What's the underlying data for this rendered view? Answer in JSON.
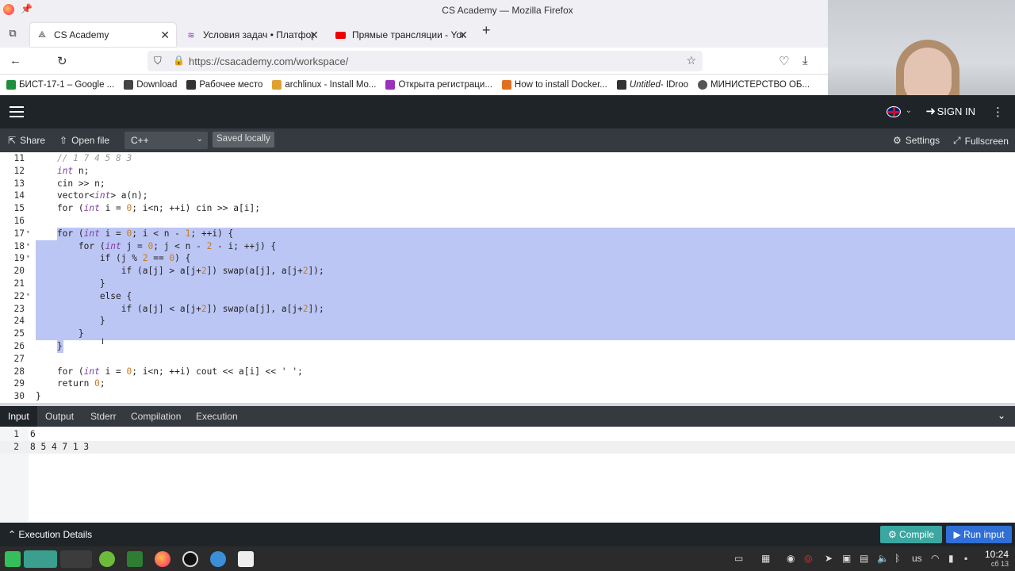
{
  "window": {
    "title": "CS Academy — Mozilla Firefox"
  },
  "tabs": [
    {
      "label": "CS Academy",
      "active": true
    },
    {
      "label": "Условия задач • Платформ",
      "active": false
    },
    {
      "label": "Прямые трансляции - YouT",
      "active": false
    }
  ],
  "url": "https://csacademy.com/workspace/",
  "bookmarks": [
    {
      "label": "БИСТ-17-1 – Google ...",
      "color": "#1e8e3e"
    },
    {
      "label": "Download",
      "color": "#444"
    },
    {
      "label": "Рабочее место",
      "color": "#333"
    },
    {
      "label": "archlinux - Install Mo...",
      "color": "#e0a030"
    },
    {
      "label": "Открыта регистраци...",
      "color": "#9b30c0"
    },
    {
      "label": "How to install Docker...",
      "color": "#e07020"
    },
    {
      "label_italic": "Untitled",
      "label": " - IDroo",
      "color": "#333"
    },
    {
      "label": "МИНИСТЕРСТВО ОБ...",
      "color": "#555"
    }
  ],
  "header": {
    "signin": "SIGN IN"
  },
  "toolbar": {
    "share": "Share",
    "open_file": "Open file",
    "language": "C++",
    "saved": "Saved locally",
    "settings": "Settings",
    "fullscreen": "Fullscreen"
  },
  "code_lines": [
    {
      "n": "11",
      "fold": "",
      "text": "    // 1 7 4 5 8 3",
      "sel": "none"
    },
    {
      "n": "12",
      "fold": "",
      "text": "    int n;",
      "sel": "none"
    },
    {
      "n": "13",
      "fold": "",
      "text": "    cin >> n;",
      "sel": "none"
    },
    {
      "n": "14",
      "fold": "",
      "text": "    vector<int> a(n);",
      "sel": "none"
    },
    {
      "n": "15",
      "fold": "",
      "text": "    for (int i = 0; i<n; ++i) cin >> a[i];",
      "sel": "none"
    },
    {
      "n": "16",
      "fold": "",
      "text": "",
      "sel": "none"
    },
    {
      "n": "17",
      "fold": "▾",
      "text": "    for (int i = 0; i < n - 1; ++i) {",
      "sel": "start"
    },
    {
      "n": "18",
      "fold": "▾",
      "text": "        for (int j = 0; j < n - 2 - i; ++j) {",
      "sel": "full"
    },
    {
      "n": "19",
      "fold": "▾",
      "text": "            if (j % 2 == 0) {",
      "sel": "full"
    },
    {
      "n": "20",
      "fold": "",
      "text": "                if (a[j] > a[j+2]) swap(a[j], a[j+2]);",
      "sel": "full"
    },
    {
      "n": "21",
      "fold": "",
      "text": "            }",
      "sel": "full"
    },
    {
      "n": "22",
      "fold": "▾",
      "text": "            else {",
      "sel": "full"
    },
    {
      "n": "23",
      "fold": "",
      "text": "                if (a[j] < a[j+2]) swap(a[j], a[j+2]);",
      "sel": "full"
    },
    {
      "n": "24",
      "fold": "",
      "text": "            }",
      "sel": "full"
    },
    {
      "n": "25",
      "fold": "",
      "text": "        }",
      "sel": "full"
    },
    {
      "n": "26",
      "fold": "",
      "text": "    }",
      "sel": "end"
    },
    {
      "n": "27",
      "fold": "",
      "text": "",
      "sel": "none"
    },
    {
      "n": "28",
      "fold": "",
      "text": "    for (int i = 0; i<n; ++i) cout << a[i] << ' ';",
      "sel": "none"
    },
    {
      "n": "29",
      "fold": "",
      "text": "    return 0;",
      "sel": "none"
    },
    {
      "n": "30",
      "fold": "",
      "text": "}",
      "sel": "none"
    }
  ],
  "io_tabs": [
    "Input",
    "Output",
    "Stderr",
    "Compilation",
    "Execution"
  ],
  "input_lines": [
    {
      "n": "1",
      "text": "6"
    },
    {
      "n": "2",
      "text": "8 5 4 7 1 3"
    }
  ],
  "footer": {
    "execution_details": "Execution Details",
    "compile": "Compile",
    "run_input": "Run input"
  },
  "taskbar": {
    "keyboard_layout": "us",
    "time": "10:24",
    "date": "сб 13"
  }
}
